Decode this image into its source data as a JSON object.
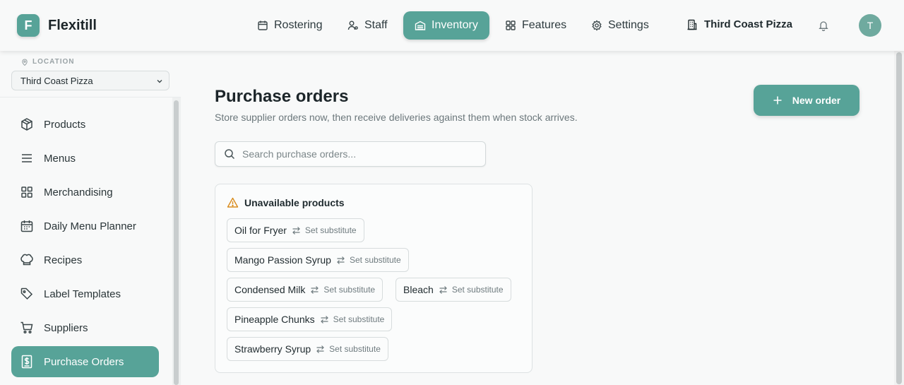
{
  "app": {
    "logo_letter": "F",
    "name": "Flexitill"
  },
  "nav": {
    "items": [
      {
        "label": "Rostering",
        "icon": "calendar-icon"
      },
      {
        "label": "Staff",
        "icon": "user-icon"
      },
      {
        "label": "Inventory",
        "icon": "inventory-icon",
        "active": true
      },
      {
        "label": "Features",
        "icon": "grid-icon"
      },
      {
        "label": "Settings",
        "icon": "gear-icon"
      }
    ],
    "location": "Third Coast Pizza",
    "avatar": "T"
  },
  "sidebar": {
    "location_label": "LOCATION",
    "location_value": "Third Coast Pizza",
    "items": [
      {
        "label": "Products",
        "icon": "box-icon"
      },
      {
        "label": "Menus",
        "icon": "menu-lines-icon"
      },
      {
        "label": "Merchandising",
        "icon": "grid-icon"
      },
      {
        "label": "Daily Menu Planner",
        "icon": "calendar-icon"
      },
      {
        "label": "Recipes",
        "icon": "chef-hat-icon"
      },
      {
        "label": "Label Templates",
        "icon": "tag-icon"
      },
      {
        "label": "Suppliers",
        "icon": "cart-icon"
      },
      {
        "label": "Purchase Orders",
        "icon": "dollar-doc-icon",
        "active": true
      }
    ]
  },
  "main": {
    "title": "Purchase orders",
    "subtitle": "Store supplier orders now, then receive deliveries against them when stock arrives.",
    "new_order_label": "New order",
    "search_placeholder": "Search purchase orders...",
    "unavailable": {
      "heading": "Unavailable products",
      "substitute_label": "Set substitute",
      "products": [
        "Oil for Fryer",
        "Mango Passion Syrup",
        "Condensed Milk",
        "Bleach",
        "Pineapple Chunks",
        "Strawberry Syrup"
      ]
    }
  },
  "colors": {
    "accent": "#57a398",
    "warning": "#d98b1c",
    "text": "#1f2a2e",
    "muted": "#6b777b"
  }
}
